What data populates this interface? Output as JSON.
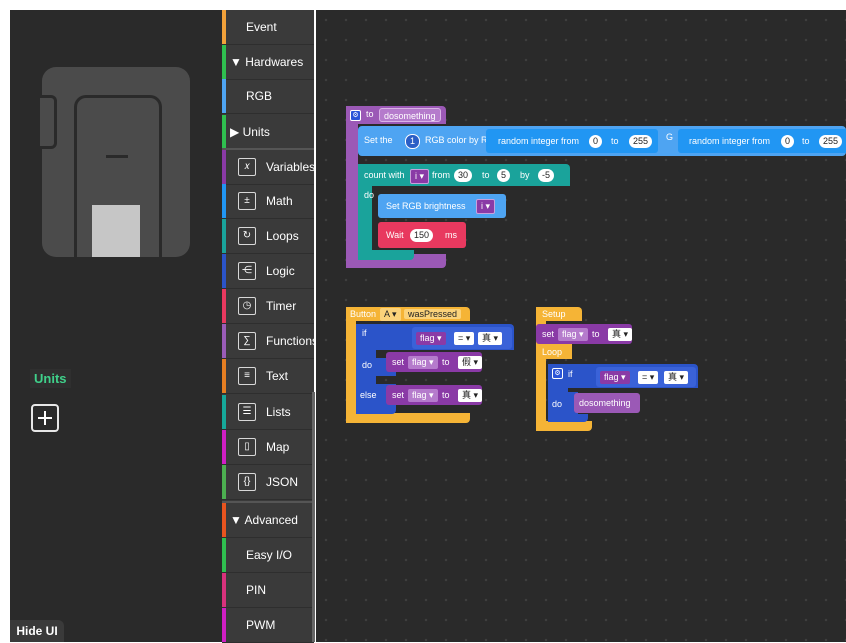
{
  "panel": {
    "units_label": "Units",
    "add_label": "+",
    "hide_ui_label": "Hide UI"
  },
  "toolbox": [
    {
      "label": "Event",
      "color": "#f2a13a",
      "kind": "sub"
    },
    {
      "label": "▼ Hardwares",
      "color": "#2fbf4f",
      "kind": "head"
    },
    {
      "label": "RGB",
      "color": "#4ea4f2",
      "kind": "sub"
    },
    {
      "label": "▶ Units",
      "color": "#2fbf4f",
      "kind": "head"
    },
    {
      "label": "Variables",
      "color": "#8a3aa6",
      "kind": "icon",
      "icon": "variables-icon",
      "glyph": "𝑥"
    },
    {
      "label": "Math",
      "color": "#2196f3",
      "kind": "icon",
      "icon": "math-icon",
      "glyph": "±"
    },
    {
      "label": "Loops",
      "color": "#1aa39b",
      "kind": "icon",
      "icon": "loops-icon",
      "glyph": "↻"
    },
    {
      "label": "Logic",
      "color": "#2b54c9",
      "kind": "icon",
      "icon": "logic-icon",
      "glyph": "⋲"
    },
    {
      "label": "Timer",
      "color": "#e8395f",
      "kind": "icon",
      "icon": "timer-icon",
      "glyph": "◷"
    },
    {
      "label": "Functions",
      "color": "#9a5cb8",
      "kind": "icon",
      "icon": "functions-icon",
      "glyph": "∑"
    },
    {
      "label": "Text",
      "color": "#e67e22",
      "kind": "icon",
      "icon": "text-icon",
      "glyph": "≡"
    },
    {
      "label": "Lists",
      "color": "#16a89a",
      "kind": "icon",
      "icon": "lists-icon",
      "glyph": "☰"
    },
    {
      "label": "Map",
      "color": "#d01fc4",
      "kind": "icon",
      "icon": "map-icon",
      "glyph": "▯"
    },
    {
      "label": "JSON",
      "color": "#4caf50",
      "kind": "icon",
      "icon": "json-icon",
      "glyph": "{}"
    },
    {
      "label": "▼ Advanced",
      "color": "#e8541f",
      "kind": "head"
    },
    {
      "label": "Easy I/O",
      "color": "#2fbf4f",
      "kind": "sub"
    },
    {
      "label": "PIN",
      "color": "#d8327c",
      "kind": "sub"
    },
    {
      "label": "PWM",
      "color": "#d01fc4",
      "kind": "sub"
    }
  ],
  "blocks": {
    "func": {
      "to": "to",
      "name": "dosomething",
      "set_the": "Set the",
      "led_index": "1",
      "rgb_color_by_r": "RGB color by R",
      "random1": "random integer from",
      "r_from": "0",
      "r_to_word": "to",
      "r_to": "255",
      "g_label": "G",
      "random2": "random integer from",
      "g_from": "0",
      "g_to_word": "to",
      "g_to": "255",
      "count_with": "count with",
      "var_i": "i",
      "from_word": "from",
      "count_from": "30",
      "to_word": "to",
      "count_to": "5",
      "by_word": "by",
      "count_by": "-5",
      "do_word": "do",
      "set_brightness": "Set RGB brightness",
      "brightness_var": "i",
      "wait": "Wait",
      "wait_value": "150",
      "ms": "ms"
    },
    "button": {
      "button_word": "Button",
      "button_id": "A",
      "event": "wasPressed",
      "if_word": "if",
      "flag1": "flag",
      "op": "=",
      "val1": "真",
      "do_word": "do",
      "set1": "set",
      "flag2": "flag",
      "to1": "to",
      "val2": "假",
      "else_word": "else",
      "set2": "set",
      "flag3": "flag",
      "to2": "to",
      "val3": "真"
    },
    "setup": {
      "setup_word": "Setup",
      "set_word": "set",
      "flag1": "flag",
      "to_word": "to",
      "val1": "真",
      "loop_word": "Loop",
      "if_word": "if",
      "flag2": "flag",
      "op": "=",
      "val2": "真",
      "do_word": "do",
      "call_name": "dosomething"
    }
  },
  "colors": {
    "function": "#9b59b6",
    "rgb": "#4ea4f2",
    "loop": "#1aa39b",
    "logic": "#2b54c9",
    "timer": "#e8395f",
    "variable": "#8a3aa6",
    "event": "#f5b436"
  }
}
